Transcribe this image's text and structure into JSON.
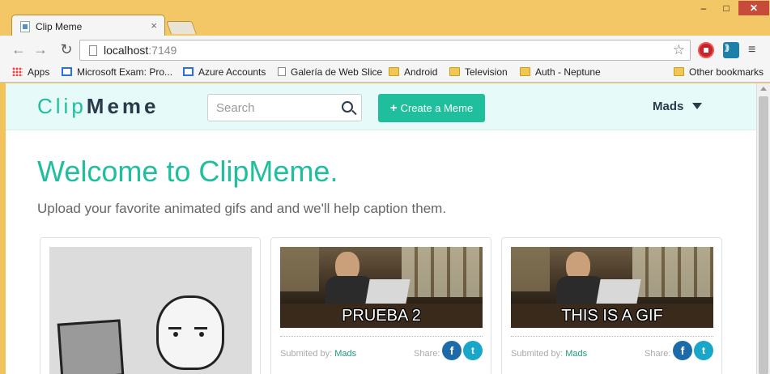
{
  "browser": {
    "tab_title": "Clip Meme",
    "tab_close": "×",
    "window_controls": {
      "minimize": "–",
      "maximize": "□",
      "close": "✕"
    },
    "url_host": "localhost",
    "url_port": ":7149",
    "nav": {
      "back": "←",
      "forward": "→",
      "reload": "↻"
    },
    "star": "☆",
    "menu": "≡",
    "icons": [
      "back-arrow-icon",
      "forward-arrow-icon",
      "reload-icon",
      "bookmark-star-icon",
      "stop-extension-icon",
      "cast-extension-icon",
      "menu-icon"
    ]
  },
  "bookmarks": {
    "items": [
      {
        "label": "Apps",
        "icon": "apps-grid-icon"
      },
      {
        "label": "Microsoft Exam: Pro...",
        "icon": "microsoft-icon"
      },
      {
        "label": "Azure Accounts",
        "icon": "microsoft-icon"
      },
      {
        "label": "Galería de Web Slice",
        "icon": "page-icon"
      },
      {
        "label": "Android",
        "icon": "folder-icon"
      },
      {
        "label": "Television",
        "icon": "folder-icon"
      },
      {
        "label": "Auth - Neptune",
        "icon": "folder-icon"
      }
    ],
    "other": "Other bookmarks"
  },
  "site": {
    "logo_part1": "Clip",
    "logo_part2": "Meme",
    "search_placeholder": "Search",
    "create_label": "Create a Meme",
    "create_icon": "+",
    "user_name": "Mads",
    "colors": {
      "accent": "#1fbf9d",
      "dark": "#2b3a4a",
      "navbar_bg": "#e6fafa"
    }
  },
  "hero": {
    "title": "Welcome to ClipMeme.",
    "subtitle": "Upload your favorite animated gifs and and we'll help caption them."
  },
  "cards": [
    {
      "caption": "",
      "image": "rage-comic-computer-guy"
    },
    {
      "caption": "PRUEBA 2",
      "submitted_label": "Submited by:",
      "author": "Mads",
      "share_label": "Share:",
      "facebook": "f",
      "twitter": "t"
    },
    {
      "caption": "THIS IS A GIF",
      "submitted_label": "Submited by:",
      "author": "Mads",
      "share_label": "Share:",
      "facebook": "f",
      "twitter": "t"
    }
  ]
}
